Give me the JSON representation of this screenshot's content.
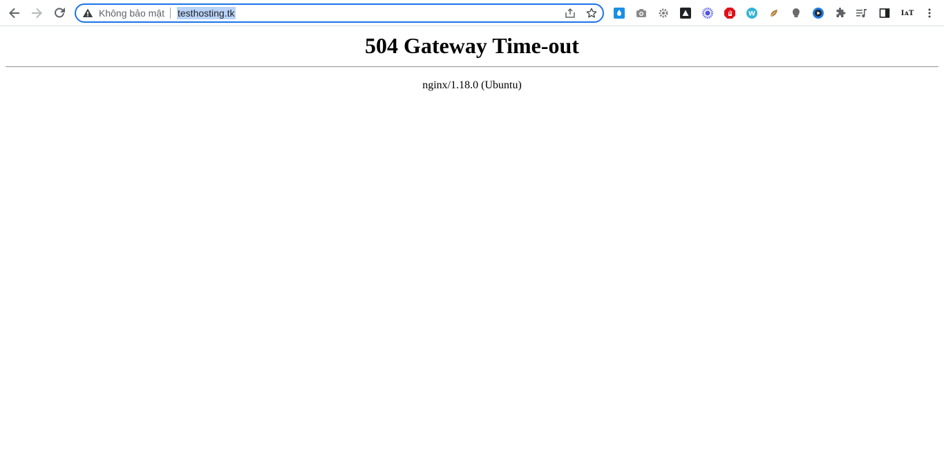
{
  "browser": {
    "security_label": "Không bảo mật",
    "url": "testhosting.tk",
    "extensions": [
      {
        "name": "droplet-extension-icon",
        "color": "#1a8fe3"
      },
      {
        "name": "camera-extension-icon",
        "color": "#8a8a8a"
      },
      {
        "name": "gear-extension-icon",
        "color": "#7a7a7a"
      },
      {
        "name": "triangle-extension-icon",
        "color": "#202124"
      },
      {
        "name": "sunburst-extension-icon",
        "color": "#4a52e0"
      },
      {
        "name": "stop-hand-extension-icon",
        "color": "#e0101a"
      },
      {
        "name": "w-extension-icon",
        "color": "#36b3d6",
        "label": "W"
      },
      {
        "name": "leaf-extension-icon",
        "color": "#b07a3a"
      },
      {
        "name": "head-extension-icon",
        "color": "#6b6b6b"
      },
      {
        "name": "play-extension-icon",
        "color": "#1f7ae0"
      },
      {
        "name": "puzzle-icon",
        "color": "#5f6368"
      },
      {
        "name": "media-queue-icon",
        "color": "#5f6368"
      },
      {
        "name": "side-panel-icon",
        "color": "#202124"
      },
      {
        "name": "translate-extension-icon",
        "color": "#202124",
        "label": "IᴀT"
      },
      {
        "name": "more-menu-icon",
        "color": "#5f6368"
      }
    ]
  },
  "page": {
    "heading": "504 Gateway Time-out",
    "server": "nginx/1.18.0 (Ubuntu)"
  }
}
